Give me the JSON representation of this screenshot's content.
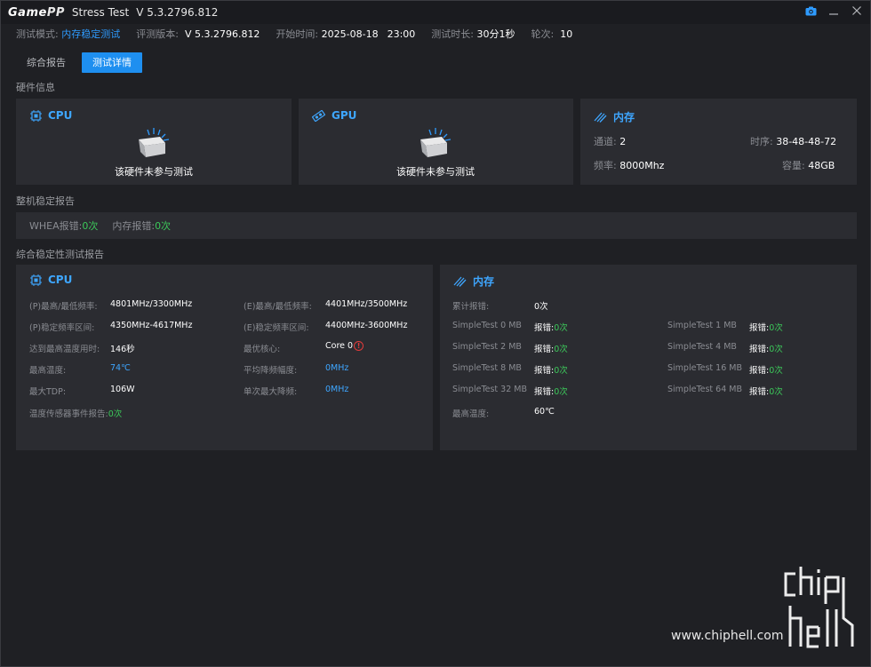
{
  "titlebar": {
    "logo_a": "Game",
    "logo_b": "PP",
    "app_name": "Stress Test",
    "version": "V 5.3.2796.812"
  },
  "info": {
    "mode_label": "测试模式:",
    "mode_value": "内存稳定测试",
    "ver_label": "评测版本:",
    "ver_value": "V 5.3.2796.812",
    "start_label": "开始时间:",
    "start_date": "2025-08-18",
    "start_time": "23:00",
    "duration_label": "测试时长:",
    "duration_value": "30分1秒",
    "rounds_label": "轮次:",
    "rounds_value": "10"
  },
  "tabs": [
    {
      "label": "综合报告"
    },
    {
      "label": "测试详情"
    }
  ],
  "sections": {
    "hardware": "硬件信息",
    "stability": "整机稳定报告",
    "summary": "综合稳定性测试报告"
  },
  "hw": {
    "cpu_title": "CPU",
    "cpu_notest": "该硬件未参与测试",
    "gpu_title": "GPU",
    "gpu_notest": "该硬件未参与测试",
    "mem_title": "内存",
    "channel_label": "通道:",
    "channel_value": "2",
    "timing_label": "时序:",
    "timing_value": "38-48-48-72",
    "freq_label": "频率:",
    "freq_value": "8000Mhz",
    "cap_label": "容量:",
    "cap_value": "48GB"
  },
  "whea": {
    "whea_label": "WHEA报错:",
    "whea_value": "0次",
    "mem_label": "内存报错:",
    "mem_value": "0次"
  },
  "cpu_report": {
    "title": "CPU",
    "p_freq_label": "(P)最高/最低频率:",
    "p_freq_value": "4801MHz/3300MHz",
    "e_freq_label": "(E)最高/最低频率:",
    "e_freq_value": "4401MHz/3500MHz",
    "p_range_label": "(P)稳定频率区间:",
    "p_range_value": "4350MHz-4617MHz",
    "e_range_label": "(E)稳定频率区间:",
    "e_range_value": "4400MHz-3600MHz",
    "maxtemp_time_label": "达到最高温度用时:",
    "maxtemp_time_value": "146秒",
    "best_core_label": "最优核心:",
    "best_core_value": "Core 0",
    "max_temp_label": "最高温度:",
    "max_temp_value": "74℃",
    "avg_drop_label": "平均降频幅度:",
    "avg_drop_value": "0MHz",
    "max_tdp_label": "最大TDP:",
    "max_tdp_value": "106W",
    "single_drop_label": "单次最大降频:",
    "single_drop_value": "0MHz",
    "sensor_label": "温度传感器事件报告:",
    "sensor_value": "0次"
  },
  "mem_report": {
    "title": "内存",
    "total_label": "累计报错:",
    "total_value": "0次",
    "err_label": "报错:",
    "tests": [
      {
        "name": "SimpleTest 0 MB",
        "value": "0次"
      },
      {
        "name": "SimpleTest 1 MB",
        "value": "0次"
      },
      {
        "name": "SimpleTest 2 MB",
        "value": "0次"
      },
      {
        "name": "SimpleTest 4 MB",
        "value": "0次"
      },
      {
        "name": "SimpleTest 8 MB",
        "value": "0次"
      },
      {
        "name": "SimpleTest 16 MB",
        "value": "0次"
      },
      {
        "name": "SimpleTest 32 MB",
        "value": "0次"
      },
      {
        "name": "SimpleTest 64 MB",
        "value": "0次"
      }
    ],
    "maxtemp_label": "最高温度:",
    "maxtemp_value": "60℃"
  },
  "watermark": {
    "url": "www.chiphell.com",
    "logo_text": "chip hell"
  },
  "colors": {
    "accent": "#1e8ff0",
    "link_blue": "#3ea6ff",
    "ok_green": "#3cc85a",
    "warn_red": "#e23b3b",
    "panel_bg": "#2b2c31",
    "window_bg": "#1f2024"
  }
}
